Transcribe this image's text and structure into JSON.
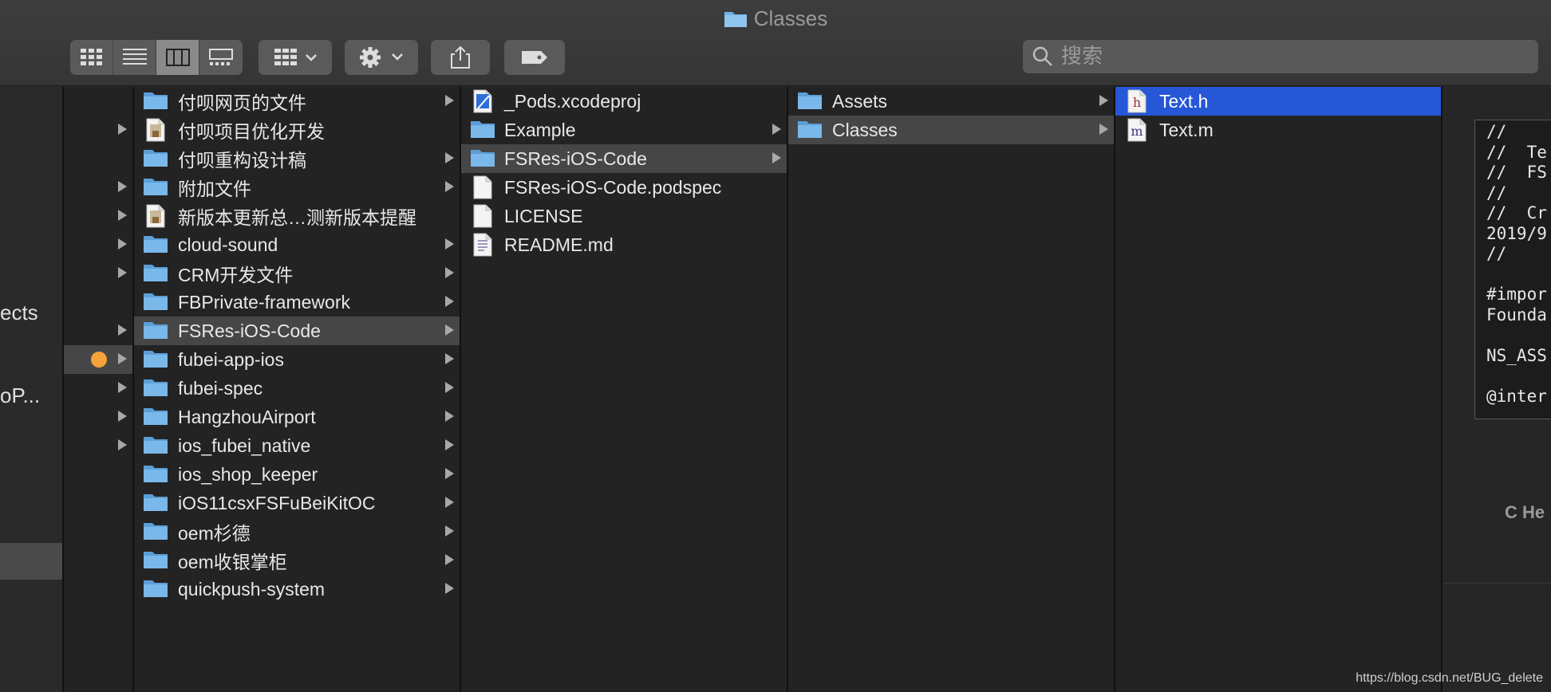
{
  "window": {
    "title": "Classes"
  },
  "toolbar": {
    "view_modes": [
      {
        "name": "icon-view",
        "active": false
      },
      {
        "name": "list-view",
        "active": false
      },
      {
        "name": "column-view",
        "active": true
      },
      {
        "name": "gallery-view",
        "active": false
      }
    ],
    "group_button_icon": "grid-dropdown-icon",
    "action_button_icon": "gear-icon",
    "share_button_icon": "share-icon",
    "tag_button_icon": "tag-icon",
    "search": {
      "placeholder": "搜索",
      "value": ""
    }
  },
  "sidebar": {
    "visible_labels": [
      "ects",
      "oP..."
    ]
  },
  "column1": {
    "items": [
      {
        "label": "付呗网页的文件",
        "type": "folder",
        "has_arrow": true,
        "left_arrow": false
      },
      {
        "label": "付呗项目优化开发",
        "type": "doc",
        "has_arrow": false,
        "left_arrow": true
      },
      {
        "label": "付呗重构设计稿",
        "type": "folder",
        "has_arrow": true,
        "left_arrow": false
      },
      {
        "label": "附加文件",
        "type": "folder",
        "has_arrow": true,
        "left_arrow": true
      },
      {
        "label": "新版本更新总…测新版本提醒",
        "type": "doc",
        "has_arrow": false,
        "left_arrow": true
      },
      {
        "label": "cloud-sound",
        "type": "folder",
        "has_arrow": true,
        "left_arrow": true
      },
      {
        "label": "CRM开发文件",
        "type": "folder",
        "has_arrow": true,
        "left_arrow": true
      },
      {
        "label": "FBPrivate-framework",
        "type": "folder",
        "has_arrow": true,
        "left_arrow": false
      },
      {
        "label": "FSRes-iOS-Code",
        "type": "folder",
        "has_arrow": true,
        "left_arrow": true,
        "selected": true
      },
      {
        "label": "fubei-app-ios",
        "type": "folder",
        "has_arrow": true,
        "left_arrow": true,
        "tag": "#f5a33a"
      },
      {
        "label": "fubei-spec",
        "type": "folder",
        "has_arrow": true,
        "left_arrow": true
      },
      {
        "label": "HangzhouAirport",
        "type": "folder",
        "has_arrow": true,
        "left_arrow": true
      },
      {
        "label": "ios_fubei_native",
        "type": "folder",
        "has_arrow": true,
        "left_arrow": true
      },
      {
        "label": "ios_shop_keeper",
        "type": "folder",
        "has_arrow": true,
        "left_arrow": false
      },
      {
        "label": "iOS11csxFSFuBeiKitOC",
        "type": "folder",
        "has_arrow": true,
        "left_arrow": false
      },
      {
        "label": "oem杉德",
        "type": "folder",
        "has_arrow": true,
        "left_arrow": false
      },
      {
        "label": "oem收银掌柜",
        "type": "folder",
        "has_arrow": true,
        "left_arrow": false
      },
      {
        "label": "quickpush-system",
        "type": "folder",
        "has_arrow": true,
        "left_arrow": false
      }
    ]
  },
  "column2": {
    "items": [
      {
        "label": "_Pods.xcodeproj",
        "type": "xcodeproj",
        "has_arrow": false
      },
      {
        "label": "Example",
        "type": "folder",
        "has_arrow": true
      },
      {
        "label": "FSRes-iOS-Code",
        "type": "folder",
        "has_arrow": true,
        "selected": true
      },
      {
        "label": "FSRes-iOS-Code.podspec",
        "type": "blank",
        "has_arrow": false
      },
      {
        "label": "LICENSE",
        "type": "blank",
        "has_arrow": false
      },
      {
        "label": "README.md",
        "type": "text",
        "has_arrow": false
      }
    ]
  },
  "column3": {
    "items": [
      {
        "label": "Assets",
        "type": "folder",
        "has_arrow": true
      },
      {
        "label": "Classes",
        "type": "folder",
        "has_arrow": true,
        "selected": true
      }
    ]
  },
  "column4": {
    "items": [
      {
        "label": "Text.h",
        "type": "header-h",
        "letter": "h",
        "selected": true
      },
      {
        "label": "Text.m",
        "type": "source-m",
        "letter": "m"
      }
    ]
  },
  "preview": {
    "code_lines": [
      "//",
      "//  Te",
      "//  FS",
      "//",
      "//  Cr",
      "2019/9",
      "//",
      "",
      "#impor",
      "Founda",
      "",
      "NS_ASS",
      "",
      "@inter"
    ],
    "kind_label": "C He"
  },
  "watermark": "https://blog.csdn.net/BUG_delete",
  "colors": {
    "selection_blue": "#2557d6",
    "selection_grey": "#464646",
    "folder_blue": "#6fb3e8"
  }
}
